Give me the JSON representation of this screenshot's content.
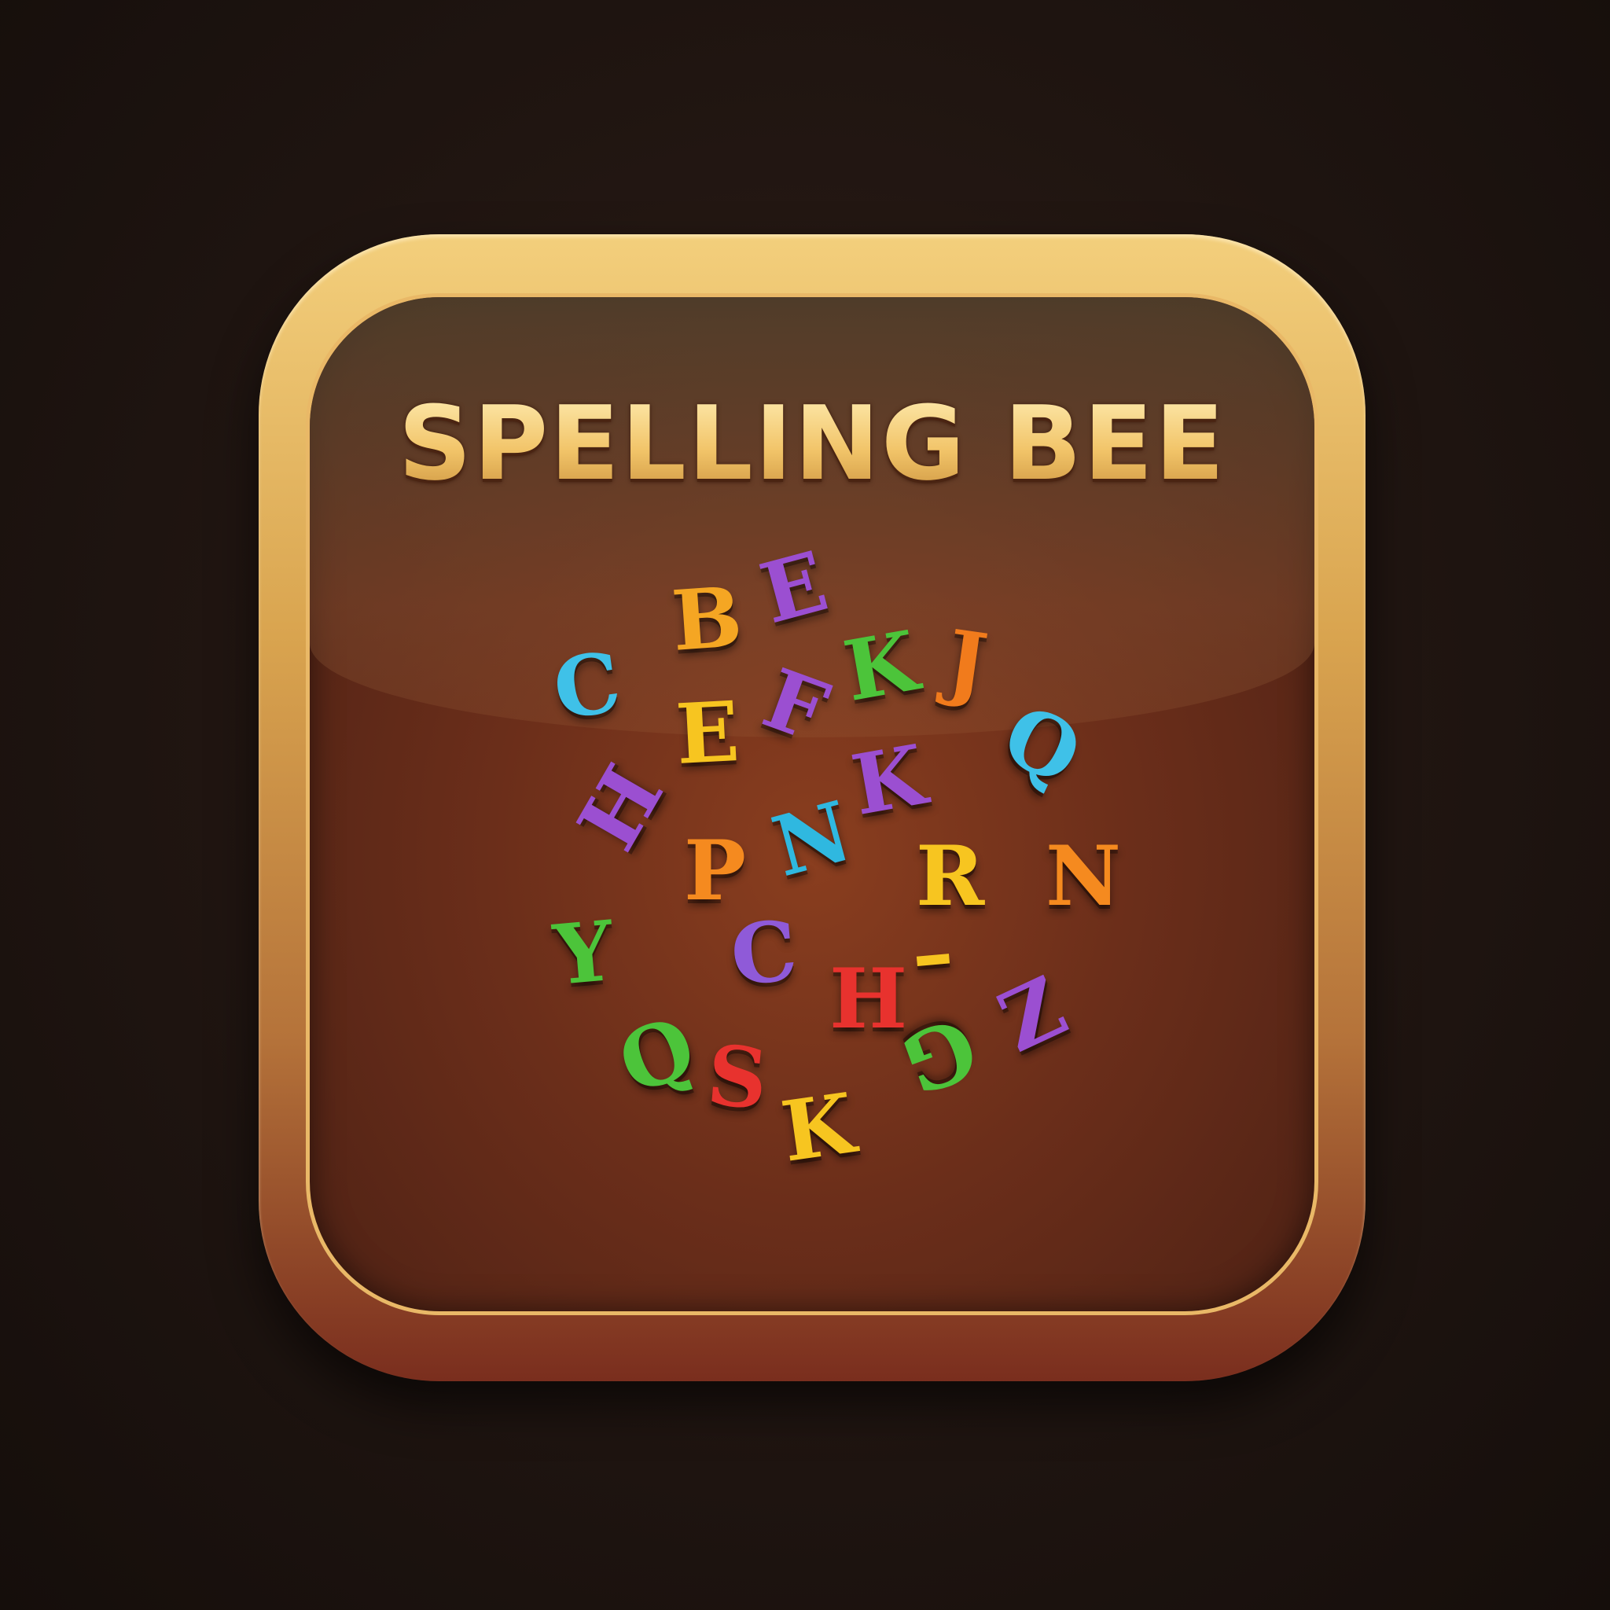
{
  "title": "SPELLING BEE",
  "colors": {
    "frame_gold": "#e9b867",
    "background": "#1e1410",
    "panel": "#6b2e1a"
  },
  "letters": [
    {
      "char": "B",
      "color": "#f5a623"
    },
    {
      "char": "E",
      "color": "#9b4fd1"
    },
    {
      "char": "C",
      "color": "#3fc1e8"
    },
    {
      "char": "E",
      "color": "#f7c520"
    },
    {
      "char": "F",
      "color": "#9b4fd1"
    },
    {
      "char": "K",
      "color": "#4cc43a"
    },
    {
      "char": "J",
      "color": "#f17b1c"
    },
    {
      "char": "Q",
      "color": "#3fc1e8"
    },
    {
      "char": "H",
      "color": "#9b4fd1"
    },
    {
      "char": "K",
      "color": "#9b4fd1"
    },
    {
      "char": "N",
      "color": "#2fb8e0"
    },
    {
      "char": "P",
      "color": "#f58a1f"
    },
    {
      "char": "R",
      "color": "#f7c520"
    },
    {
      "char": "N",
      "color": "#f58a1f"
    },
    {
      "char": "Y",
      "color": "#4cc43a"
    },
    {
      "char": "C",
      "color": "#8f5ad8"
    },
    {
      "char": "H",
      "color": "#e8322e"
    },
    {
      "char": "–",
      "color": "#f7c520"
    },
    {
      "char": "Z",
      "color": "#9b4fd1"
    },
    {
      "char": "G",
      "color": "#4cc43a"
    },
    {
      "char": "Q",
      "color": "#4cc43a"
    },
    {
      "char": "S",
      "color": "#e8322e"
    },
    {
      "char": "K",
      "color": "#f7c520"
    }
  ]
}
